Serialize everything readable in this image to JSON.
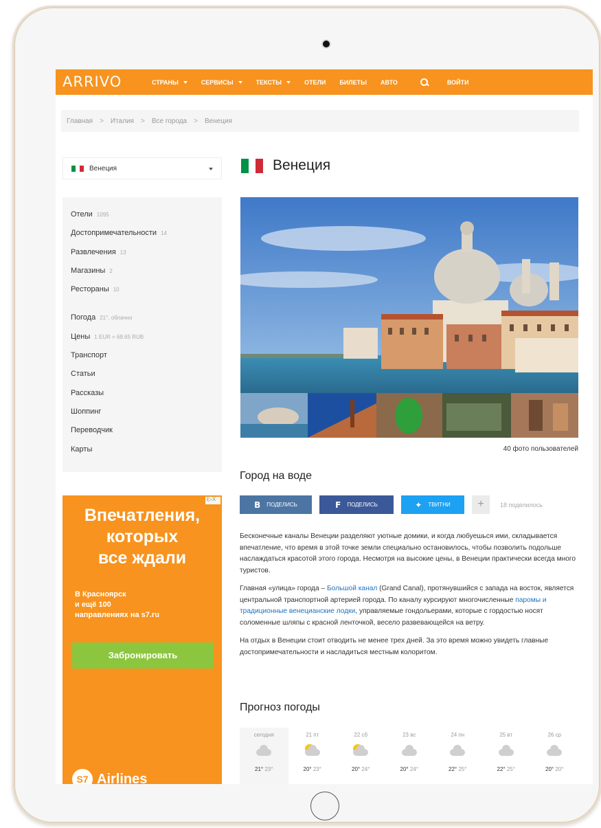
{
  "header": {
    "logo": "ARRIVO",
    "nav": [
      {
        "label": "СТРАНЫ",
        "dropdown": true
      },
      {
        "label": "СЕРВИСЫ",
        "dropdown": true
      },
      {
        "label": "ТЕКСТЫ",
        "dropdown": true
      },
      {
        "label": "ОТЕЛИ",
        "dropdown": false
      },
      {
        "label": "БИЛЕТЫ",
        "dropdown": false
      },
      {
        "label": "АВТО",
        "dropdown": false
      }
    ],
    "login": "ВОЙТИ",
    "accent_color": "#f7931e"
  },
  "breadcrumb": [
    "Главная",
    "Италия",
    "Все города",
    "Венеция"
  ],
  "breadcrumb_separator": ">",
  "sidebar": {
    "city_select": "Венеция",
    "menu_primary": [
      {
        "label": "Отели",
        "count": "1095"
      },
      {
        "label": "Достопримечательности",
        "count": "14"
      },
      {
        "label": "Развлечения",
        "count": "13"
      },
      {
        "label": "Магазины",
        "count": "2"
      },
      {
        "label": "Рестораны",
        "count": "10"
      }
    ],
    "menu_secondary": [
      {
        "label": "Погода",
        "count": "21°, облачно"
      },
      {
        "label": "Цены",
        "count": "1 EUR = 68.65 RUB"
      },
      {
        "label": "Транспорт",
        "count": ""
      },
      {
        "label": "Статьи",
        "count": ""
      },
      {
        "label": "Рассказы",
        "count": ""
      },
      {
        "label": "Шоппинг",
        "count": ""
      },
      {
        "label": "Переводчик",
        "count": ""
      },
      {
        "label": "Карты",
        "count": ""
      }
    ]
  },
  "ad": {
    "title_lines": [
      "Впечатления,",
      "которых",
      "все ждали"
    ],
    "text_lines": [
      "В Красноярск",
      "и ещё 100",
      "направлениях на s7.ru"
    ],
    "button": "Забронировать",
    "brand_mark": "S7",
    "brand": "Airlines"
  },
  "main": {
    "title": "Венеция",
    "photo_count": "40 фото пользователей",
    "section_title": "Город на воде",
    "share": {
      "vk": "ПОДЕЛИСЬ",
      "fb": "ПОДЕЛИСЬ",
      "tw": "ТВИТНИ",
      "plus": "+",
      "count": "18 поделилось"
    },
    "paragraph1": "Бесконечные каналы Венеции разделяют уютные домики, и когда любуешься ими, складывается впечатление, что время в этой точке земли специально остановилось, чтобы позволить подольше наслаждаться красотой этого города. Несмотря на высокие цены, в Венеции практически всегда много туристов.",
    "paragraph2": {
      "t1": "Главная «улица» города – ",
      "link1": "Большой канал",
      "t2": " (Grand Canal), протянувшийся с запада на восток, является центральной транспортной артерией города. По каналу курсируют многочисленные ",
      "link2": "паромы и традиционные венецианские лодки",
      "t3": ", управляемые гондольерами, которые с гордостью носят соломенные шляпы с красной ленточкой, весело развевающейся на ветру."
    },
    "paragraph3": "На отдых в Венеции стоит отводить не менее трех дней. За это время можно увидеть главные достопримечательности и насладиться местным колоритом.",
    "weather_title": "Прогноз погоды",
    "weather": [
      {
        "day": "сегодня",
        "icon": "cloud-icon",
        "hi": "21°",
        "lo": "23°"
      },
      {
        "day": "21 пт",
        "icon": "sun-cloud-icon",
        "hi": "20°",
        "lo": "23°"
      },
      {
        "day": "22 сб",
        "icon": "sun-cloud-icon",
        "hi": "20°",
        "lo": "24°"
      },
      {
        "day": "23 вс",
        "icon": "cloud-icon",
        "hi": "20°",
        "lo": "24°"
      },
      {
        "day": "24 пн",
        "icon": "cloud-icon",
        "hi": "22°",
        "lo": "25°"
      },
      {
        "day": "25 вт",
        "icon": "cloud-icon",
        "hi": "22°",
        "lo": "25°"
      },
      {
        "day": "26 ср",
        "icon": "cloud-icon",
        "hi": "20°",
        "lo": "20°"
      }
    ]
  },
  "flag_colors": [
    "#009246",
    "#ffffff",
    "#ce2b37"
  ]
}
